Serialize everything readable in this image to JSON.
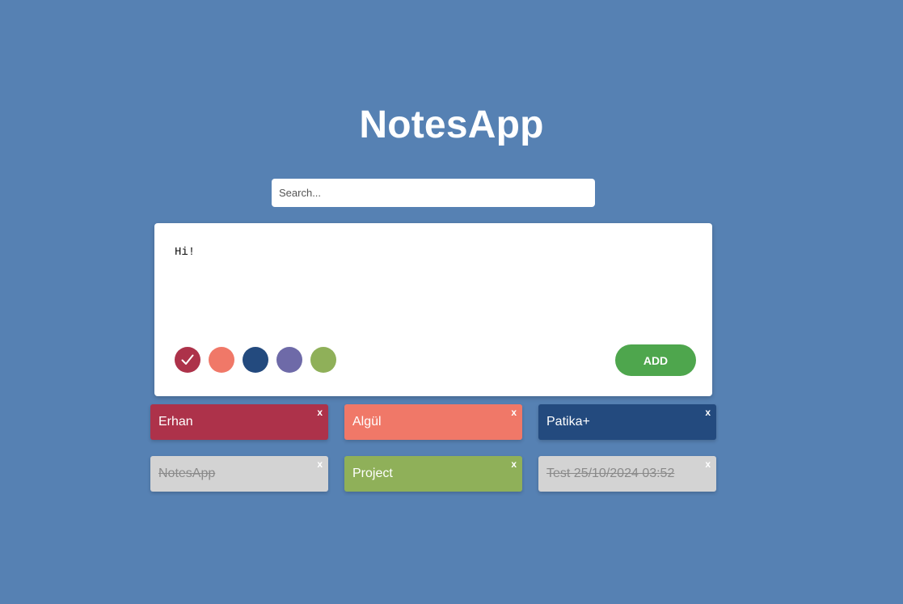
{
  "app": {
    "title": "NotesApp"
  },
  "search": {
    "placeholder": "Search...",
    "value": ""
  },
  "editor": {
    "text": "Hi!",
    "add_label": "ADD",
    "add_color": "#4ea64d",
    "colors": [
      {
        "hex": "#ad324a",
        "selected": true
      },
      {
        "hex": "#f07868",
        "selected": false
      },
      {
        "hex": "#234a7e",
        "selected": false
      },
      {
        "hex": "#6e6aa8",
        "selected": false
      },
      {
        "hex": "#8fb059",
        "selected": false
      }
    ],
    "selected_icon": "check-icon"
  },
  "notes": [
    {
      "text": "Erhan",
      "color": "#ad324a",
      "done": false,
      "delete_label": "x"
    },
    {
      "text": "Algül",
      "color": "#f07868",
      "done": false,
      "delete_label": "x"
    },
    {
      "text": "Patika+",
      "color": "#234a7e",
      "done": false,
      "delete_label": "x"
    },
    {
      "text": "NotesApp",
      "color": "#d3d3d3",
      "done": true,
      "delete_label": "x"
    },
    {
      "text": "Project",
      "color": "#8fb059",
      "done": false,
      "delete_label": "x"
    },
    {
      "text": "Test 25/10/2024 03:52",
      "color": "#d3d3d3",
      "done": true,
      "delete_label": "x"
    }
  ]
}
